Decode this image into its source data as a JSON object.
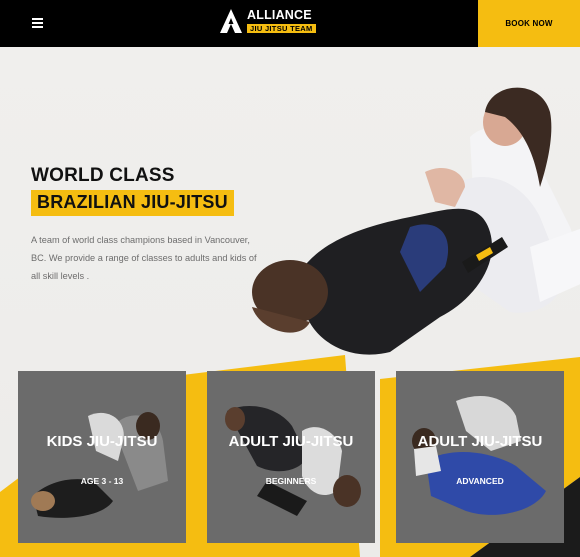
{
  "header": {
    "menu_icon": "hamburger-menu-icon",
    "logo": {
      "top": "ALLIANCE",
      "bottom": "JIU JITSU TEAM"
    },
    "book_now_label": "BOOK NOW"
  },
  "hero": {
    "title_line1": "WORLD CLASS",
    "title_line2": "BRAZILIAN JIU-JITSU",
    "description": "A team of world class champions based in Vancouver, BC. We provide a range of classes to adults and kids of all skill levels ."
  },
  "cards": [
    {
      "title": "KIDS JIU-JITSU",
      "subtitle": "AGE 3 - 13"
    },
    {
      "title": "ADULT JIU-JITSU",
      "subtitle": "BEGINNERS"
    },
    {
      "title": "ADULT JIU-JITSU",
      "subtitle": "ADVANCED"
    }
  ],
  "colors": {
    "header_bg": "#000000",
    "accent_yellow": "#f5bd11",
    "card_bg": "#6b6b6b",
    "hero_bg": "#efeeec"
  }
}
